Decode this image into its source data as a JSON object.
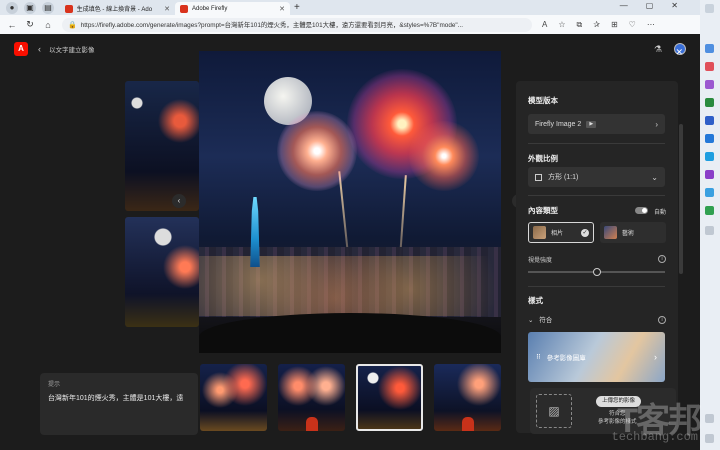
{
  "browser": {
    "tabs": [
      {
        "label": "生成填色 - 線上換背景 - Ado",
        "active": false
      },
      {
        "label": "Adobe Firefly",
        "active": true
      }
    ],
    "new_tab": "+",
    "url": "https://firefly.adobe.com/generate/images?prompt=台灣新年101的煙火秀，主體是101大樓，遠方還要看到月亮，&styles=%7B\"mode\"..."
  },
  "header": {
    "title": "以文字建立影像"
  },
  "prompt": {
    "label": "提示",
    "text": "台灣新年101的煙火秀，主體是101大樓，遠"
  },
  "panel": {
    "model_title": "模型版本",
    "model_value": "Firefly Image 2",
    "aspect_title": "外觀比例",
    "aspect_value": "方形 (1:1)",
    "content_type_title": "內容類型",
    "auto_label": "自動",
    "photo_label": "相片",
    "art_label": "藝術",
    "visual_intensity": "視覺強度",
    "visual_intensity_level": 0.5,
    "style_title": "樣式",
    "match_label": "符合",
    "ref_gallery": "參考影像圖庫",
    "upload_button": "上傳您的影像",
    "upload_note_1": "符合您",
    "upload_note_2": "參考影像的樣式"
  },
  "watermark": {
    "main": "T客邦",
    "sub": "techbang.com"
  },
  "colors": {
    "accent": "#fa0f00",
    "bg": "#1c1c1c",
    "panel": "#252525"
  }
}
